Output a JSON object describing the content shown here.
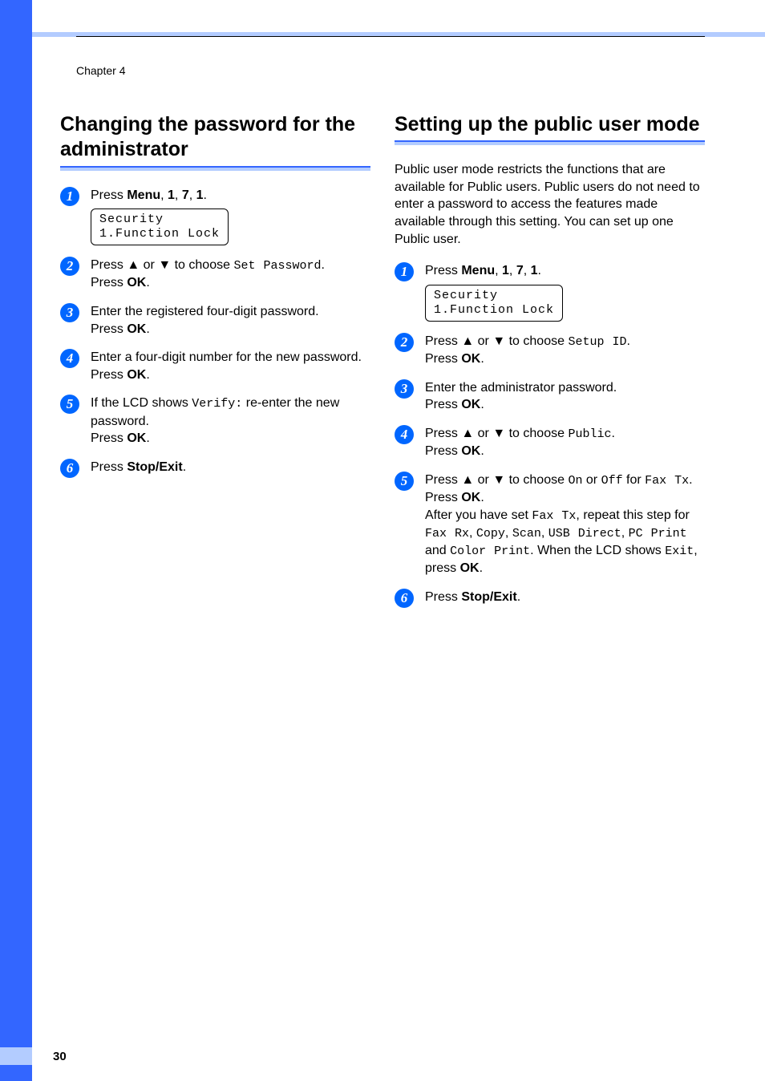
{
  "chapter": "Chapter 4",
  "page_number": "30",
  "left": {
    "heading": "Changing the password for the administrator",
    "steps": {
      "s1_a": "Press ",
      "s1_menu": "Menu",
      "s1_b": ", ",
      "s1_k1": "1",
      "s1_c": ", ",
      "s1_k2": "7",
      "s1_d": ", ",
      "s1_k3": "1",
      "s1_e": ".",
      "lcd_line1": "Security",
      "lcd_line2": "1.Function Lock",
      "s2_a": "Press ",
      "s2_up": "▲",
      "s2_b": " or ",
      "s2_down": "▼",
      "s2_c": " to choose ",
      "s2_code": "Set Password",
      "s2_d": ".",
      "s2_press": "Press ",
      "s2_ok": "OK",
      "s2_dot": ".",
      "s3_a": "Enter the registered four-digit password.",
      "s3_press": "Press ",
      "s3_ok": "OK",
      "s3_dot": ".",
      "s4_a": "Enter a four-digit number for the new password.",
      "s4_press": "Press ",
      "s4_ok": "OK",
      "s4_dot": ".",
      "s5_a": "If the LCD shows ",
      "s5_code": "Verify:",
      "s5_b": " re-enter the new password.",
      "s5_press": "Press ",
      "s5_ok": "OK",
      "s5_dot": ".",
      "s6_press": "Press ",
      "s6_stop": "Stop/Exit",
      "s6_dot": "."
    }
  },
  "right": {
    "heading": "Setting up the public user mode",
    "intro": "Public user mode restricts the functions that are available for Public users. Public users do not need to enter a password to access the features made available through this setting. You can set up one Public user.",
    "steps": {
      "s1_a": "Press ",
      "s1_menu": "Menu",
      "s1_b": ", ",
      "s1_k1": "1",
      "s1_c": ", ",
      "s1_k2": "7",
      "s1_d": ", ",
      "s1_k3": "1",
      "s1_e": ".",
      "lcd_line1": "Security",
      "lcd_line2": "1.Function Lock",
      "s2_a": "Press ",
      "s2_up": "▲",
      "s2_b": " or ",
      "s2_down": "▼",
      "s2_c": " to choose ",
      "s2_code": "Setup ID",
      "s2_d": ".",
      "s2_press": "Press ",
      "s2_ok": "OK",
      "s2_dot": ".",
      "s3_a": "Enter the administrator password.",
      "s3_press": "Press ",
      "s3_ok": "OK",
      "s3_dot": ".",
      "s4_a": "Press ",
      "s4_up": "▲",
      "s4_b": " or ",
      "s4_down": "▼",
      "s4_c": " to choose ",
      "s4_code": "Public",
      "s4_d": ".",
      "s4_press": "Press ",
      "s4_ok": "OK",
      "s4_dot": ".",
      "s5_a": "Press ",
      "s5_up": "▲",
      "s5_b": " or ",
      "s5_down": "▼",
      "s5_c": " to choose ",
      "s5_on": "On",
      "s5_or": " or ",
      "s5_off": "Off",
      "s5_for": " for ",
      "s5_faxtx": "Fax Tx",
      "s5_pdot": ".",
      "s5_press": "Press ",
      "s5_ok": "OK",
      "s5_dot": ".",
      "s5_after_a": "After you have set ",
      "s5_after_faxtx": "Fax Tx",
      "s5_after_b": ", repeat this step for ",
      "s5_faxrx": "Fax Rx",
      "s5_comma1": ", ",
      "s5_copy": "Copy",
      "s5_comma2": ", ",
      "s5_scan": "Scan",
      "s5_comma3": ", ",
      "s5_usb": "USB Direct",
      "s5_comma4": ", ",
      "s5_pc": "PC Print",
      "s5_and": " and ",
      "s5_color": "Color Print",
      "s5_when": ". When the LCD shows ",
      "s5_exit": "Exit",
      "s5_presslast": ", press ",
      "s5_oklast": "OK",
      "s5_dotlast": ".",
      "s6_press": "Press ",
      "s6_stop": "Stop/Exit",
      "s6_dot": "."
    }
  }
}
